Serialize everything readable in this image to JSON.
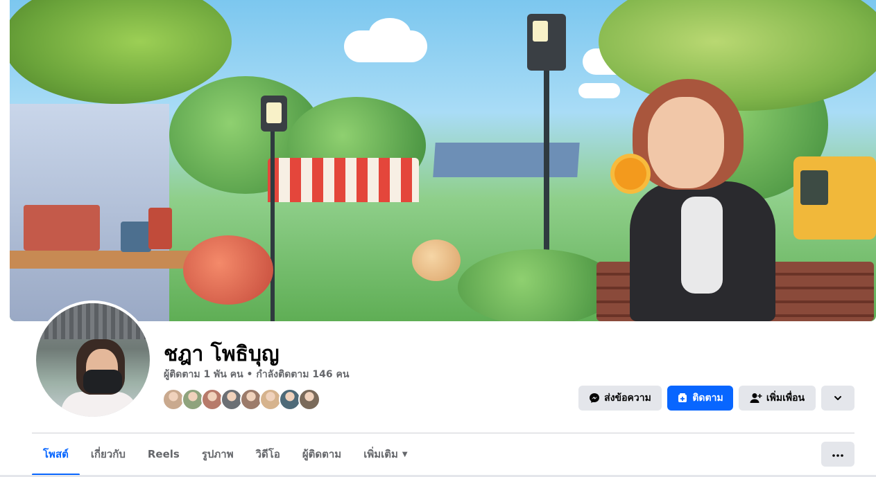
{
  "profile": {
    "name": "ชฎา โพธิบุญ",
    "stats": "ผู้ติดตาม 1 พัน คน • กำลังติดตาม 146 คน",
    "friend_avatar_colors": [
      "#c9a98e",
      "#8fa37d",
      "#b77a6a",
      "#6b6f74",
      "#9c7b6a",
      "#d6b38d",
      "#4e6a78",
      "#7a6a5a"
    ]
  },
  "actions": {
    "message_label": "ส่งข้อความ",
    "follow_label": "ติดตาม",
    "add_friend_label": "เพิ่มเพื่อน"
  },
  "tabs": [
    {
      "label": "โพสต์",
      "active": true
    },
    {
      "label": "เกี่ยวกับ",
      "active": false
    },
    {
      "label": "Reels",
      "active": false
    },
    {
      "label": "รูปภาพ",
      "active": false
    },
    {
      "label": "วิดีโอ",
      "active": false
    },
    {
      "label": "ผู้ติดตาม",
      "active": false
    },
    {
      "label": "เพิ่มเติม",
      "active": false
    }
  ],
  "colors": {
    "accent": "#0866ff",
    "button_gray": "#e4e6eb",
    "text_primary": "#050505",
    "text_secondary": "#65676b"
  },
  "icons": {
    "message": "messenger-icon",
    "follow": "follow-icon",
    "add_friend": "add-friend-icon",
    "dropdown": "chevron-down-icon",
    "more": "more-horizontal-icon",
    "tab_caret": "caret-down-icon"
  }
}
